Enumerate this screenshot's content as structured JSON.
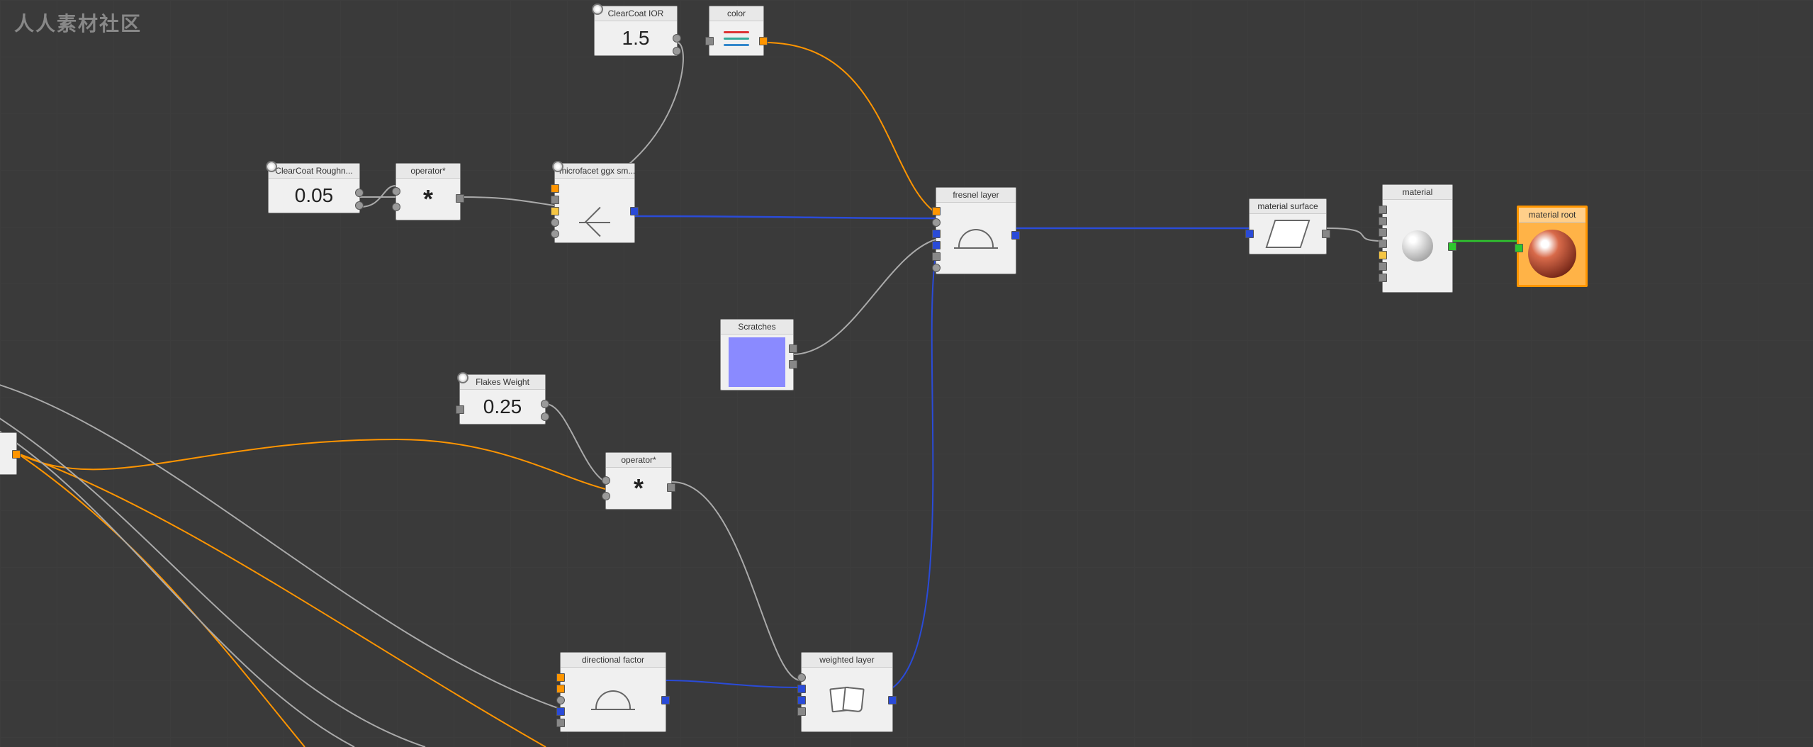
{
  "watermark": "人人素材社区",
  "nodes": {
    "clearcoat_ior": {
      "title": "ClearCoat IOR",
      "value": "1.5"
    },
    "color": {
      "title": "color"
    },
    "clearcoat_rough": {
      "title": "ClearCoat Roughn...",
      "value": "0.05"
    },
    "operator1": {
      "title": "operator*",
      "symbol": "*"
    },
    "microfacet": {
      "title": "microfacet ggx sm..."
    },
    "fresnel": {
      "title": "fresnel layer"
    },
    "matsurface": {
      "title": "material surface"
    },
    "material": {
      "title": "material"
    },
    "matroot": {
      "title": "material root"
    },
    "scratches": {
      "title": "Scratches"
    },
    "flakes": {
      "title": "Flakes Weight",
      "value": "0.25"
    },
    "operator2": {
      "title": "operator*",
      "symbol": "*"
    },
    "dirfactor": {
      "title": "directional factor"
    },
    "weighted": {
      "title": "weighted layer"
    }
  }
}
